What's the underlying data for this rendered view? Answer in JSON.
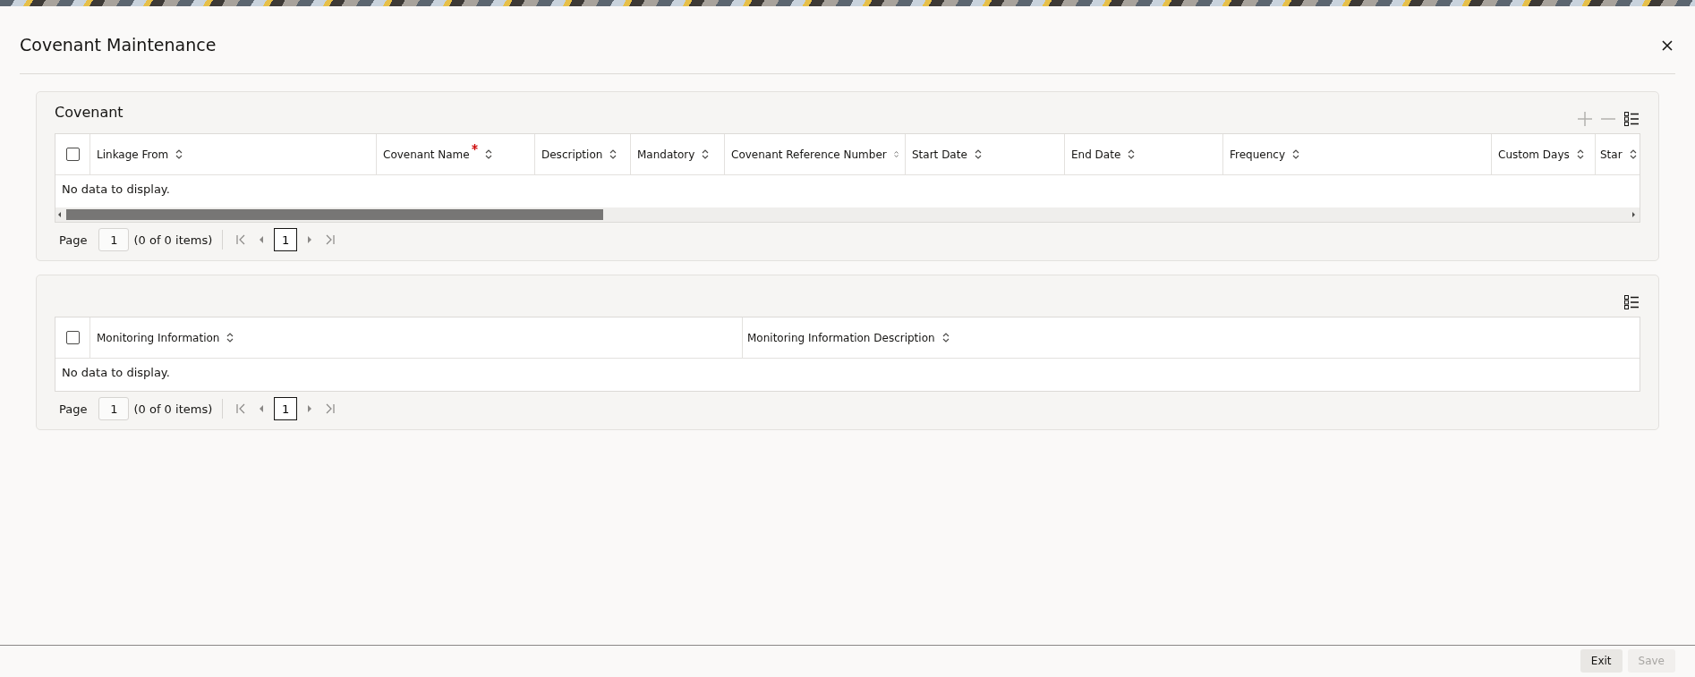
{
  "window": {
    "title": "Covenant Maintenance"
  },
  "covenant_panel": {
    "title": "Covenant",
    "toolbar": [
      {
        "kind": "add"
      },
      {
        "kind": "remove"
      },
      {
        "kind": "columns"
      }
    ],
    "table": {
      "select_all": {
        "checked": false
      },
      "columns": [
        {
          "label": "Linkage From",
          "required": false
        },
        {
          "label": "Covenant Name",
          "required": true
        },
        {
          "label": "Description",
          "required": false
        },
        {
          "label": "Mandatory",
          "required": false
        },
        {
          "label": "Covenant Reference Number",
          "required": false
        },
        {
          "label": "Start Date",
          "required": false
        },
        {
          "label": "End Date",
          "required": false
        },
        {
          "label": "Frequency",
          "required": false
        },
        {
          "label": "Custom Days",
          "required": false
        },
        {
          "label": "Star",
          "required": false
        }
      ],
      "empty_text": "No data to display."
    },
    "pager": {
      "label": "Page",
      "page": "1",
      "count": "(0 of 0 items)",
      "current": "1"
    }
  },
  "monitoring_panel": {
    "toolbar": [
      {
        "kind": "columns"
      }
    ],
    "table": {
      "select_all": {
        "checked": false
      },
      "columns": [
        {
          "label": "Monitoring Information",
          "required": false
        },
        {
          "label": "Monitoring Information Description",
          "required": false
        }
      ],
      "empty_text": "No data to display."
    },
    "pager": {
      "label": "Page",
      "page": "1",
      "count": "(0 of 0 items)",
      "current": "1"
    }
  },
  "buttons": [
    {
      "label": "Exit",
      "disabled": false
    },
    {
      "label": "Save",
      "disabled": true
    }
  ]
}
